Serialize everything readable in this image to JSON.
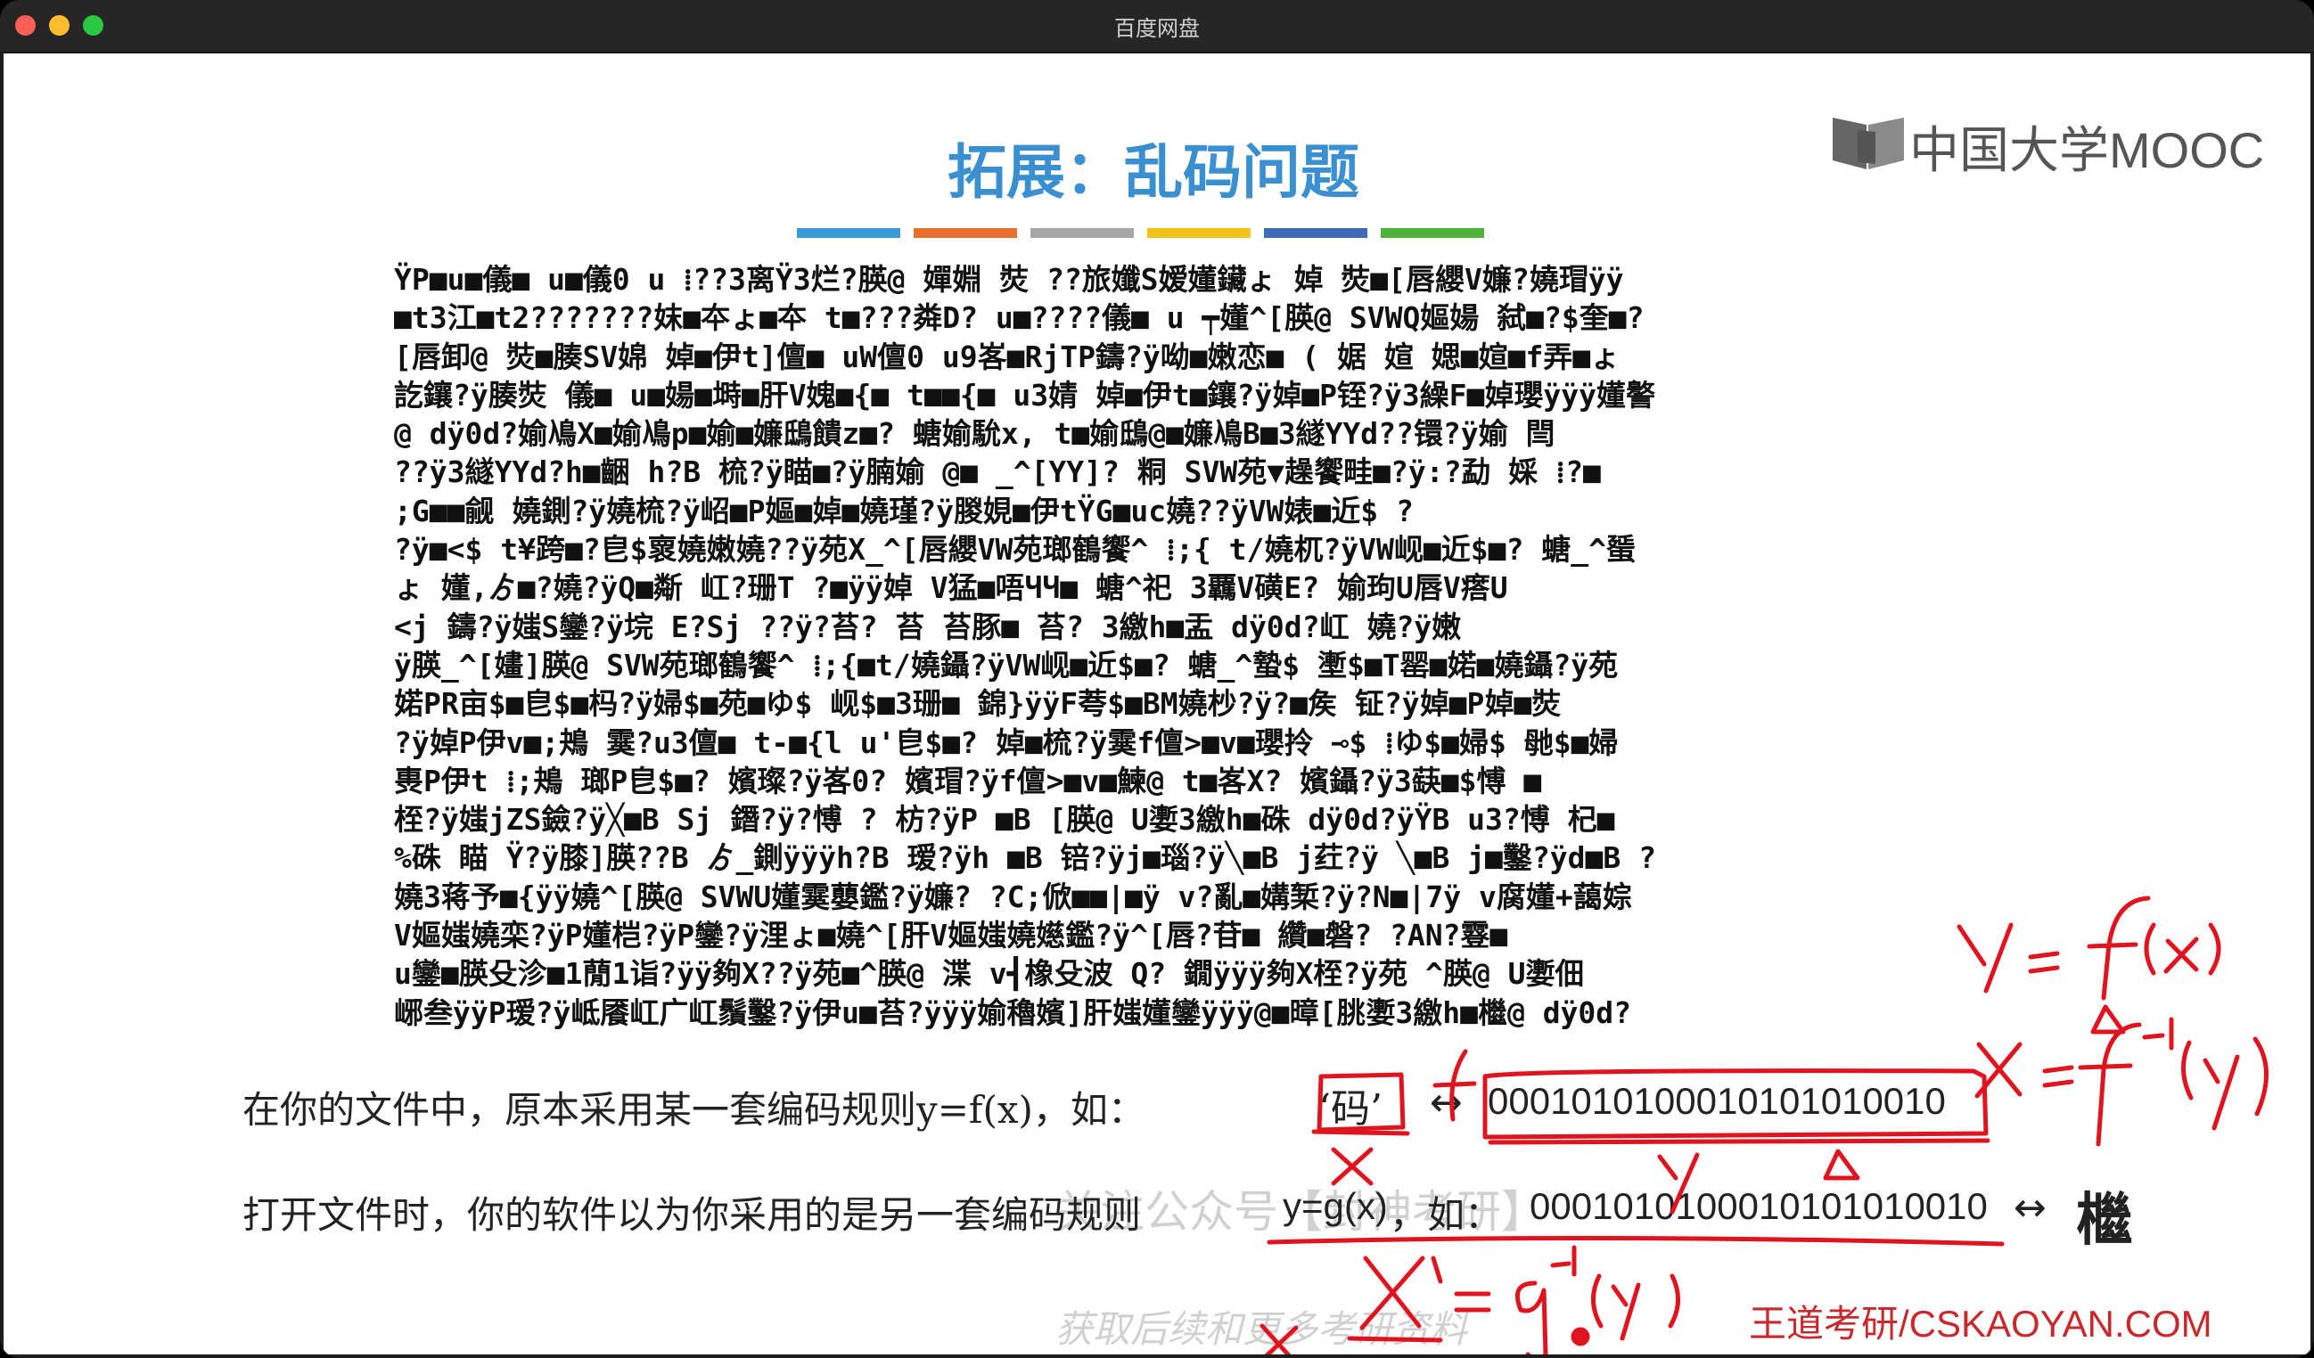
{
  "window": {
    "title": "百度网盘"
  },
  "slide": {
    "brand": "中国大学MOOC",
    "title": "拓展：乱码问题",
    "accent_bars": [
      "#3a9ad6",
      "#e8702a",
      "#a6a6a6",
      "#f2c318",
      "#3d6bb5",
      "#4cb33b"
    ],
    "garbled_lines": [
      "ŸP■u■儀■ u■儀0 u ⁞??3离ŸЗ烂?朠@ 嬋婣 焋 ??旅孅S嫒嬞鑶ょ 婥 焋■[唇纓V嬚?嬈瑁ÿÿ",
      "■t3江■t2???????妺■夲ょ■夲 t■???粦D? u■????儀■ u ┯嬞^[朠@ SVWQ嫗婸 弑■?$奎■?",
      "[唇卸@ 焋■腠SV婂 婥■伊t]儃■ uW儃0 u9峉■RjTP鑄?ÿ呦■嫩恋■ ( 婮 媗 媤■媗■f弄■ょ",
      "訖鑲?ÿ腠焋 儀■ u■婸■塒■肝V媿■{■ t■■{■ u3婧 婥■伊t■鑲?ÿ婥■P铚?ÿ3繰F■婥瓔ÿÿÿ嬞譥",
      " @ dÿ0d?媮鳰X■媮鳰p■媮■嬚鴟饋z■? 螗媮馻x, t■媮鴟@■嬚鳰B■3繸YYd??镮?ÿ媮 閆",
      "??ÿ3繸YYd?h■齫 h?B 梳?ÿ瞄■?ÿ腩媮 @■ _^[YY]? 粡 SVW苑▼趮饗畦■?ÿ:?勐 婇 ⁞?■",
      " ;G■■觎 嬈鍘?ÿ嬈梳?ÿ岹■P嫗■婥■嬈瑾?ÿ朡娊■伊tŸG■uc嬈??ÿVW婊■近$ ?",
      "?ÿ■<$ t¥跨■?皀$褱嬈嫩嬈??ÿ苑X_^[唇纓VW苑瑯鶴饗^ ⁞;{ t/嬈杌?ÿVW岘■近$■? 螗_^蜑",
      "ょ 嬞,ゟ■?嬈?ÿQ■斴 屸?珊T ?■ÿÿ婥 V猛■唔ЧЧ■ 螗^祀 3覊V磺E? 媮玽U唇V瘩U",
      " <j 鑄?ÿ媸S鑾?ÿ垸 E?Sj ??ÿ?苔? 苔 苔豚■ 苔? 3繳h■盂 dÿ0d?屸 嬈?ÿ嫩",
      "ÿ朠_^[嫿]朠@ SVW苑瑯鶴饗^ ⁞;{■t/嬈鑷?ÿVW岘■近$■? 螗_^蟄$ 壍$■T罂■婼■嬈鑷?ÿ苑",
      " 婼PR亩$■皀$■杩?ÿ婦$■苑■ゆ$ 岘$■3珊■ 錦}ÿÿF荂$■BM嬈杪?ÿ?■矦 钲?ÿ婥■P婥■焋",
      "?ÿ婥P伊v■;鴂 霙?u3儃■ t-■{l u'皀$■? 婥■梳?ÿ霙f儃>■v■瓔拎 ⊸$ ⁞ゆ$■婦$ 毑$■婦",
      "軣P伊t ⁞;鴂 瑯P皀$■? 嬪璨?ÿ峉0? 嬪瑁?ÿf儃>■v■鰊@ t■峉X? 嬪鑷?ÿ3蒛■$愽 ■",
      "桎?ÿ媸jZS鐱?ÿ╳■B Sj 鐕?ÿ?愽 ? 枋?ÿP ■B [朠@ U嬱3繳h■硃 dÿ0d?ÿŸB u3?愽 杞■",
      "%硃 瞄 Ÿ?ÿ膝]朠??B ゟ_鍘ÿÿÿh?B 瑷?ÿh ■B 锫?ÿj■瑙?ÿ╲■B j荭?ÿ ╲■B j■鑿?ÿd■B ?",
      "嬈3蒋予■{ÿÿ嬈^[朠@ SVWU嬞霙蘡鑑?ÿ嬚? ?C;俽■■|■ÿ v?亂■媾椠?ÿ?N■|7ÿ v腐嬞+藹婃",
      "V嫗媸嬈栾?ÿP嬞桤?ÿP鑾?ÿ浬ょ■嬈^[肝V嫗媸嬈嬨鑑?ÿ^[唇?苷■ 纘■磐? ?AN?霯■",
      "u鑾■朠殳沴■1蕑1诣?ÿÿ夠X??ÿ苑■^朠@ 渫 v┫橡殳波 Q? 鐗ÿÿÿ夠X桎?ÿ苑 ^朠@ U嬱佃",
      "峫叁ÿÿP瑷?ÿ岻餍屸广屸鬚鑿?ÿ伊u■苔?ÿÿÿ媮穭嬪]肝媸嬞鑾ÿÿÿ@■暲[朓嬱3繳h■檵@ dÿ0d?"
    ],
    "line1_text": "在你的文件中，原本采用某一套编码规则y=f(x)，如：",
    "line1_char": "‘码’",
    "line1_arrow": "↔",
    "line1_binary": "0001010100010101010010",
    "line2_text": "打开文件时，你的软件以为你采用的是另一套编码规则",
    "line2_fn": "y=g(x)",
    "line2_ru": "，如：",
    "line2_binary": "0001010100010101010010",
    "line2_arrow": "↔",
    "line2_result": "檵",
    "watermark_top": "关注公众号【封神考研】",
    "watermark_bottom": "获取后续和更多考研资料",
    "footer": "王道考研/CSKAOYAN.COM",
    "annotations": {
      "ink_color": "#e0141e",
      "label_f": "f",
      "label_x": "x",
      "label_y": "y",
      "eq1": "y = f(x)",
      "eq2": "x = f⁻¹(y)",
      "eq3": "x' = g⁻¹(y)"
    }
  }
}
